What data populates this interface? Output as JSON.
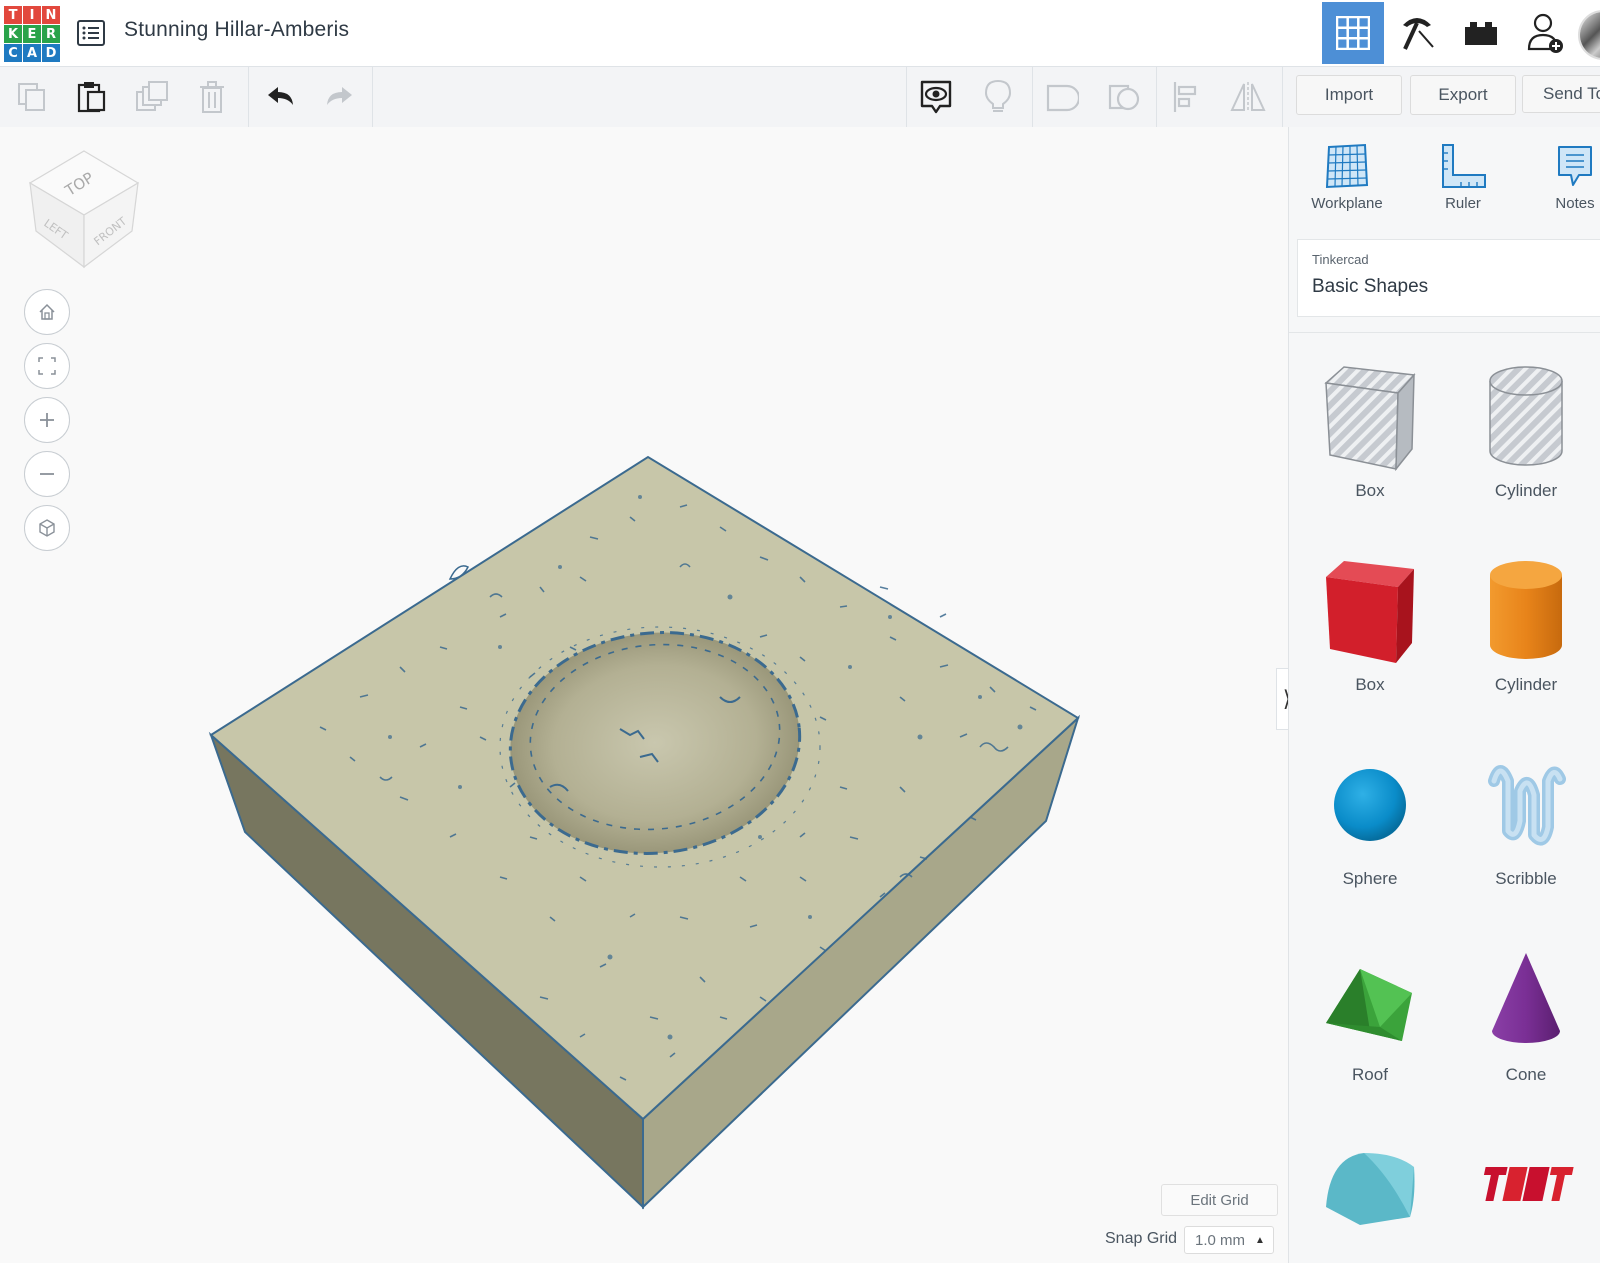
{
  "header": {
    "logo_letters": [
      "T",
      "I",
      "N",
      "K",
      "E",
      "R",
      "C",
      "A",
      "D"
    ],
    "logo_colors": [
      "#e2483d",
      "#e2483d",
      "#e2483d",
      "#2aa34a",
      "#2aa34a",
      "#2aa34a",
      "#1f7ac1",
      "#1f7ac1",
      "#1f7ac1"
    ],
    "title": "Stunning Hillar-Amberis",
    "accent_color": "#4d8fd6"
  },
  "toolbar": {
    "import_label": "Import",
    "export_label": "Export",
    "send_to_label": "Send To"
  },
  "panel": {
    "tools": [
      {
        "label": "Workplane",
        "icon": "workplane-icon"
      },
      {
        "label": "Ruler",
        "icon": "ruler-icon"
      },
      {
        "label": "Notes",
        "icon": "notes-icon"
      }
    ],
    "library_provider": "Tinkercad",
    "library_name": "Basic Shapes",
    "shapes": [
      {
        "label": "Box",
        "icon": "box-hole-icon"
      },
      {
        "label": "Cylinder",
        "icon": "cylinder-hole-icon"
      },
      {
        "label": "Box",
        "icon": "box-icon"
      },
      {
        "label": "Cylinder",
        "icon": "cylinder-icon"
      },
      {
        "label": "Sphere",
        "icon": "sphere-icon"
      },
      {
        "label": "Scribble",
        "icon": "scribble-icon"
      },
      {
        "label": "Roof",
        "icon": "roof-icon"
      },
      {
        "label": "Cone",
        "icon": "cone-icon"
      },
      {
        "label": "",
        "icon": "round-roof-icon"
      },
      {
        "label": "",
        "icon": "text-icon"
      }
    ]
  },
  "viewcube": {
    "top": "TOP",
    "left": "LEFT",
    "front": "FRONT"
  },
  "footer": {
    "edit_grid_label": "Edit Grid",
    "snap_grid_label": "Snap Grid",
    "snap_grid_value": "1.0 mm"
  }
}
